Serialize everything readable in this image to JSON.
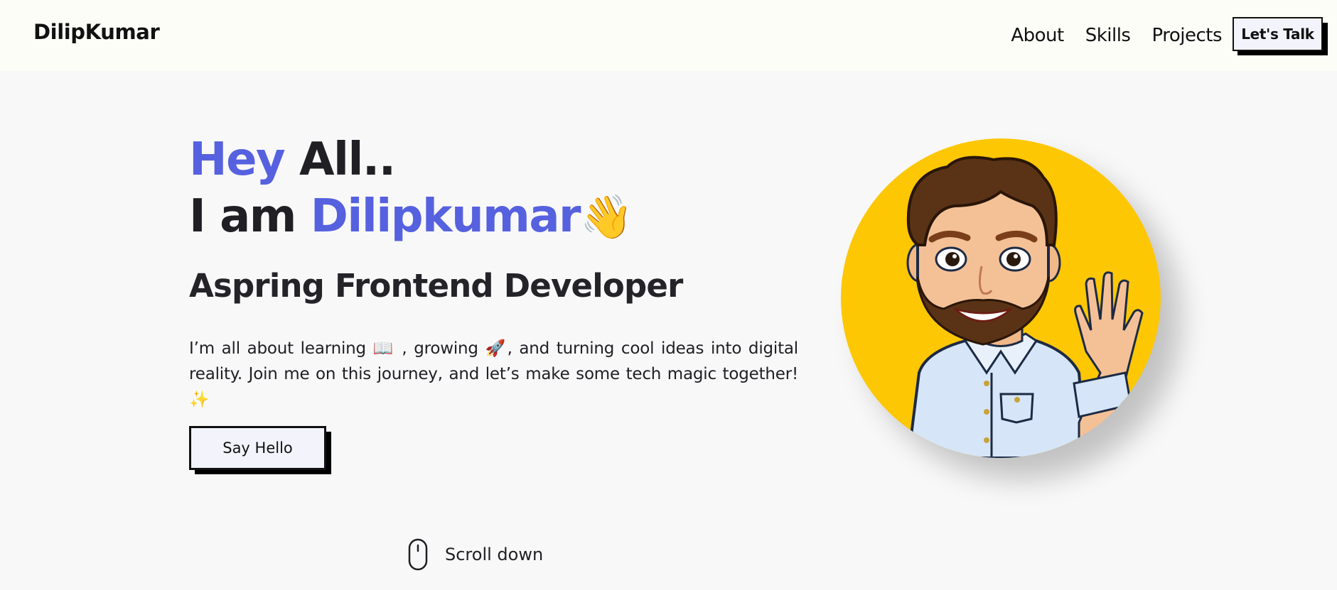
{
  "header": {
    "brand": "DilipKumar",
    "nav": [
      "About",
      "Skills",
      "Projects"
    ],
    "cta": "Let's Talk"
  },
  "hero": {
    "line1_accent": "Hey",
    "line1_rest": "All..",
    "line2_prefix": "I am",
    "line2_name": "Dilipkumar",
    "wave_emoji": "👋",
    "subtitle": "Aspring Frontend Developer",
    "description": "I’m all about learning 📖 , growing 🚀, and turning cool ideas into digital reality. Join me on this journey, and let’s make some tech magic together! ✨",
    "button": "Say Hello",
    "scroll_label": "Scroll down",
    "avatar_icon": "memoji-avatar"
  },
  "colors": {
    "accent": "#5661df",
    "avatar_bg": "#fdc704",
    "header_bg": "#fdfdf8",
    "page_bg": "#f8f8f9"
  }
}
